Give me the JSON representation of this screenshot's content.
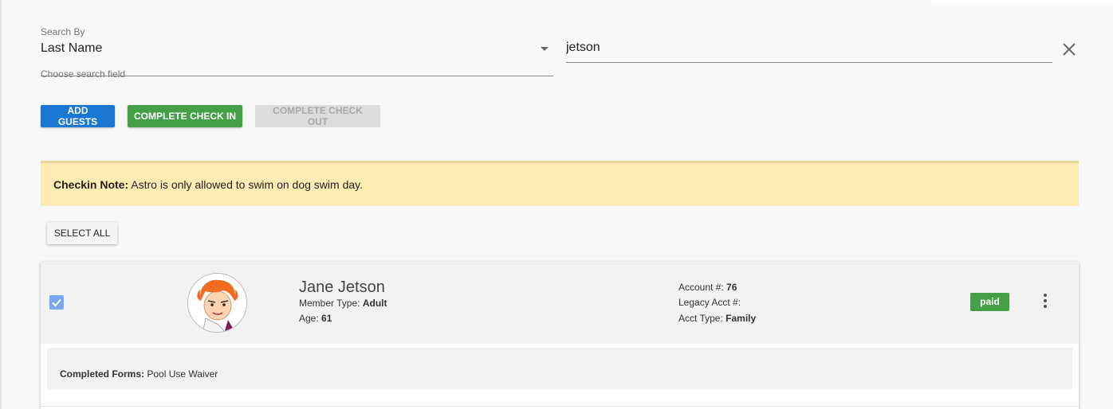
{
  "search": {
    "label": "Search By",
    "field_value": "Last Name",
    "hint": "Choose search field",
    "query_value": "jetson"
  },
  "actions": {
    "add_guests": "ADD GUESTS",
    "complete_check_in": "COMPLETE CHECK IN",
    "complete_check_out": "COMPLETE CHECK OUT",
    "select_all": "SELECT ALL"
  },
  "note": {
    "label": "Checkin Note:",
    "text": "Astro is only allowed to swim on dog swim day."
  },
  "member": {
    "name": "Jane Jetson",
    "member_type_label": "Member Type:",
    "member_type": "Adult",
    "age_label": "Age:",
    "age": "61",
    "account_label": "Account #:",
    "account": "76",
    "legacy_label": "Legacy Acct #:",
    "legacy": "",
    "acct_type_label": "Acct Type:",
    "acct_type": "Family",
    "status": "paid",
    "selected": true,
    "forms_label": "Completed Forms:",
    "forms": "Pool Use Waiver"
  },
  "colors": {
    "primary": "#1976d2",
    "success": "#43a047",
    "note_bg": "#ffecb3",
    "checkbox": "#7aa7ef"
  },
  "icons": [
    "dropdown-arrow-icon",
    "close-icon",
    "checkbox-checked-icon",
    "avatar-image",
    "more-vert-icon"
  ]
}
